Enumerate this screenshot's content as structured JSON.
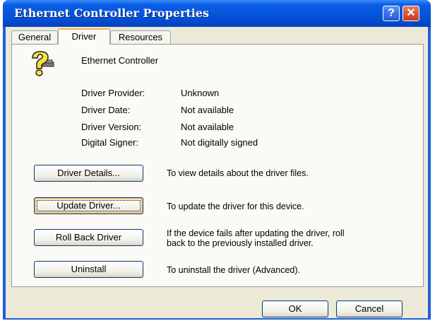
{
  "window": {
    "title": "Ethernet Controller Properties"
  },
  "titlebar_buttons": {
    "help": "?",
    "close": "✕"
  },
  "tabs": [
    {
      "label": "General"
    },
    {
      "label": "Driver"
    },
    {
      "label": "Resources"
    }
  ],
  "device": {
    "name": "Ethernet Controller",
    "icon": "unknown-device-question-icon"
  },
  "properties": [
    {
      "label": "Driver Provider:",
      "value": "Unknown"
    },
    {
      "label": "Driver Date:",
      "value": "Not available"
    },
    {
      "label": "Driver Version:",
      "value": "Not available"
    },
    {
      "label": "Digital Signer:",
      "value": "Not digitally signed"
    }
  ],
  "actions": [
    {
      "label": "Driver Details...",
      "desc": "To view details about the driver files."
    },
    {
      "label": "Update Driver...",
      "desc": "To update the driver for this device."
    },
    {
      "label": "Roll Back Driver",
      "desc_line1": "If the device fails after updating the driver, roll",
      "desc_line2": "back to the previously installed driver."
    },
    {
      "label": "Uninstall",
      "desc": "To uninstall the driver (Advanced)."
    }
  ],
  "footer": {
    "ok": "OK",
    "cancel": "Cancel"
  },
  "colors": {
    "titlebar": "#0453d8",
    "face": "#ece9d8",
    "focus_ring": "#f7c471"
  }
}
